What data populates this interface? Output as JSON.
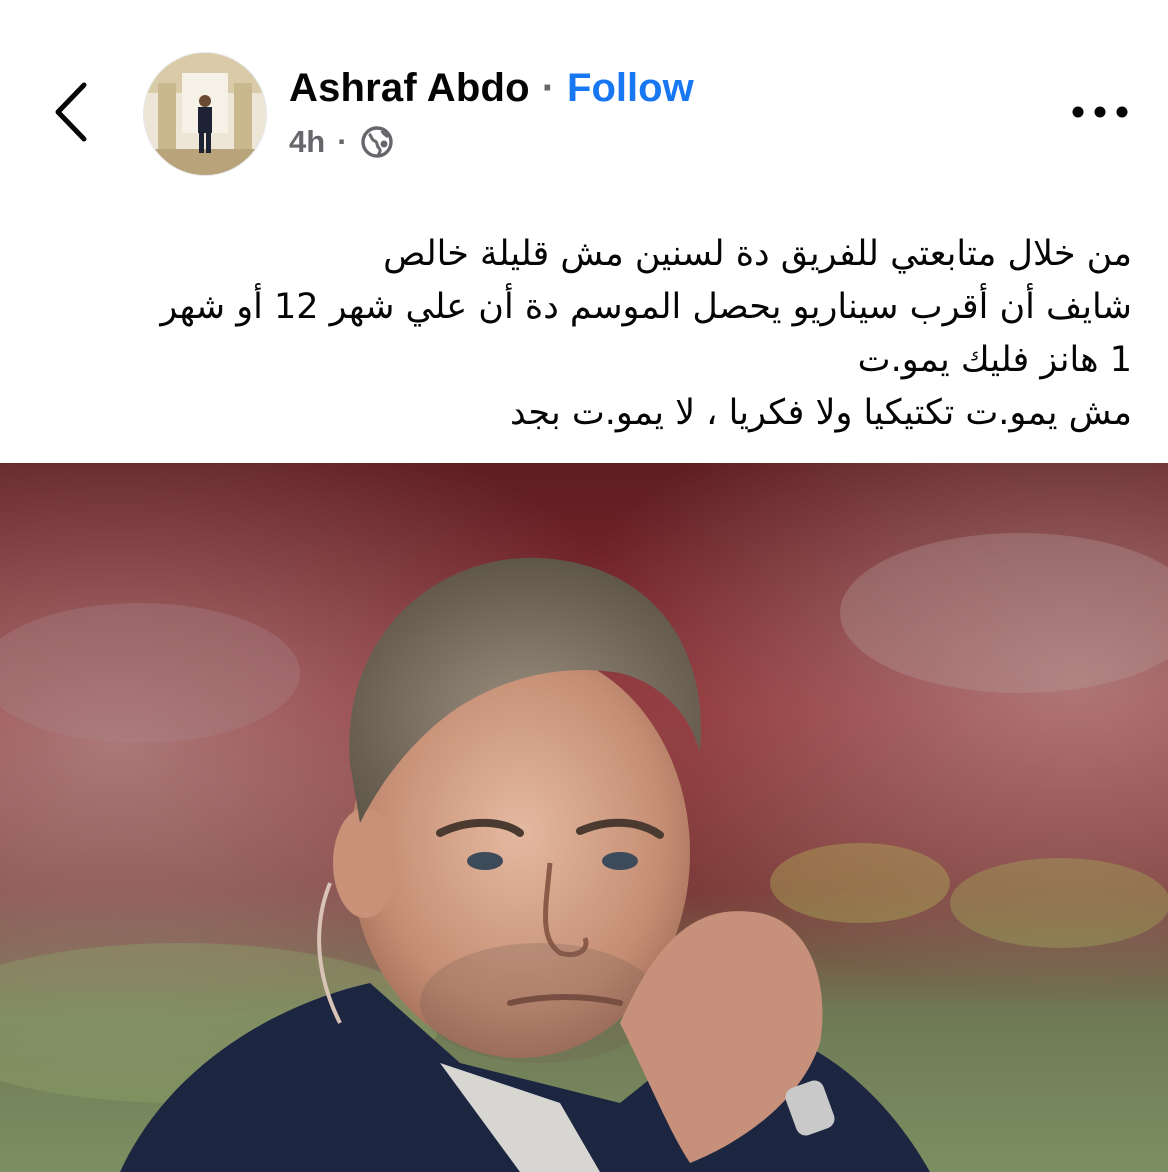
{
  "header": {
    "back_icon": "chevron-left-icon",
    "author_name": "Ashraf Abdo",
    "separator": "·",
    "follow_label": "Follow",
    "time": "4h",
    "meta_separator": "·",
    "audience_icon": "globe-icon",
    "more_icon": "more-horizontal-icon"
  },
  "post": {
    "lines": [
      "من خلال متابعتي للفريق دة لسنين مش قليلة خالص",
      "شايف أن أقرب سيناريو يحصل  الموسم دة أن علي شهر 12 أو شهر",
      "1 هانز فليك يمو.ت",
      "مش يمو.ت تكتيكيا ولا فكريا ، لا يمو.ت بجد"
    ]
  },
  "colors": {
    "follow_blue": "#1877f2",
    "meta_gray": "#65676b",
    "text_black": "#050505"
  }
}
